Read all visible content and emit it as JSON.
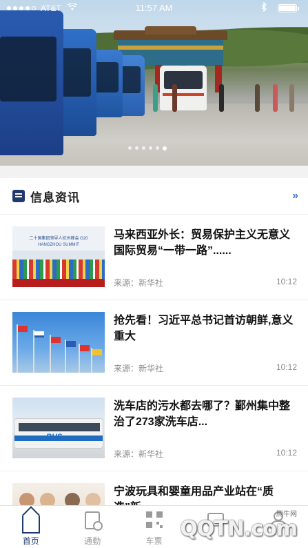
{
  "status_bar": {
    "carrier": "AT&T",
    "time": "11:57 AM",
    "bluetooth_icon": "bluetooth-icon",
    "battery_icon": "battery-icon",
    "wifi_icon": "wifi-icon"
  },
  "banner": {
    "page_count": 6,
    "active_index": 5
  },
  "section": {
    "title": "信息资讯",
    "icon": "news-icon",
    "more_icon": "double-chevron-right-icon",
    "more_label": "»"
  },
  "news": [
    {
      "headline": "马来西亚外长：贸易保护主义无意义国际贸易“一带一路”......",
      "source": "来源：新华社",
      "time": "10:12",
      "thumb_caption": "二十国集团领导人杭州峰会 G20 HANGZHOU SUMMIT"
    },
    {
      "headline": "抢先看！习近平总书记首访朝鲜,意义重大",
      "source": "来源：新华社",
      "time": "10:12"
    },
    {
      "headline": "洗车店的污水都去哪了？鄞州集中整治了273家洗车店...",
      "source": "来源：新华社",
      "time": "10:12",
      "thumb_caption": "BUS"
    },
    {
      "headline": "宁波玩具和婴童用品产业站在“质造”新...",
      "source": "",
      "time": ""
    }
  ],
  "tabbar": {
    "tabs": [
      {
        "label": "首页",
        "icon": "home-icon",
        "active": true
      },
      {
        "label": "通勤",
        "icon": "commute-icon",
        "active": false
      },
      {
        "label": "车票",
        "icon": "qr-code-icon",
        "active": false
      },
      {
        "label": "",
        "icon": "ticket-icon",
        "active": false
      },
      {
        "label": "",
        "icon": "user-icon",
        "active": false
      }
    ]
  },
  "watermark": {
    "text": "QQTN.com",
    "small": "腾牛网"
  }
}
